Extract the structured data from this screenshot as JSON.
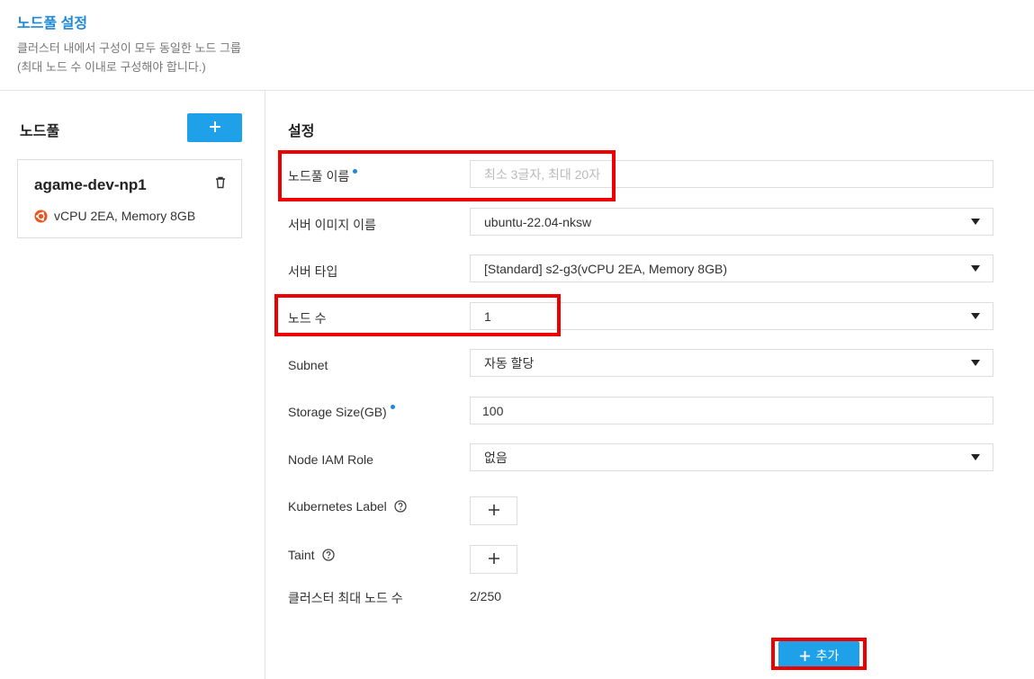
{
  "header": {
    "title": "노드풀 설정",
    "desc1": "클러스터 내에서 구성이 모두 동일한 노드 그룹",
    "desc2": "(최대 노드 수 이내로 구성해야 합니다.)"
  },
  "nodepool_panel": {
    "title": "노드풀",
    "card": {
      "name": "agame-dev-np1",
      "spec": "vCPU 2EA, Memory 8GB",
      "os_icon": "ubuntu-icon"
    }
  },
  "settings": {
    "title": "설정",
    "name_label": "노드풀 이름",
    "name_placeholder": "최소 3글자, 최대 20자",
    "image_label": "서버 이미지 이름",
    "image_value": "ubuntu-22.04-nksw",
    "type_label": "서버 타입",
    "type_value": "[Standard] s2-g3(vCPU 2EA, Memory 8GB)",
    "count_label": "노드 수",
    "count_value": "1",
    "subnet_label": "Subnet",
    "subnet_value": "자동 할당",
    "storage_label": "Storage Size(GB)",
    "storage_value": "100",
    "iam_label": "Node IAM Role",
    "iam_value": "없음",
    "k8s_label": "Kubernetes Label",
    "taint_label": "Taint",
    "max_label": "클러스터 최대 노드 수",
    "max_value": "2/250",
    "submit_label": "추가"
  },
  "colors": {
    "accent": "#1ea1e8",
    "title_blue": "#1e88d9",
    "highlight": "#e00000"
  }
}
